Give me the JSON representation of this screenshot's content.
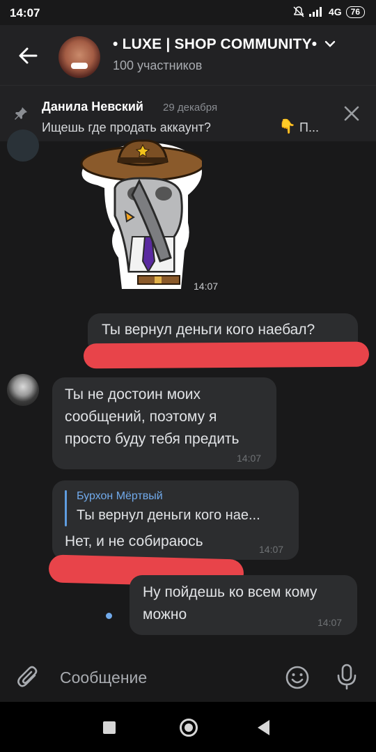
{
  "status_bar": {
    "time": "14:07",
    "network": "4G",
    "battery": "76"
  },
  "header": {
    "title": "• LUXE | SHOP COMMUNITY•",
    "subtitle": "100 участников"
  },
  "pinned": {
    "author": "Данила Невский",
    "date": "29 декабря",
    "text": "Ищешь где продать аккаунт?",
    "emoji": "👇",
    "more": "П..."
  },
  "messages": {
    "sticker_time": "14:07",
    "m1": {
      "text": "Ты вернул деньги кого наебал?"
    },
    "m2": {
      "lines": [
        "Ты не достоин моих",
        "сообщений, поэтому я",
        "просто буду тебя предить"
      ],
      "time": "14:07"
    },
    "m3": {
      "reply_author": "Бурхон Мёртвый",
      "reply_text": "Ты вернул деньги кого нае...",
      "text": "Нет, и не собираюсь",
      "time": "14:07"
    },
    "m4": {
      "lines": [
        "Ну пойдешь ко всем кому",
        "можно"
      ],
      "time": "14:07"
    }
  },
  "composer": {
    "placeholder": "Сообщение"
  },
  "icons": {
    "back": "arrow-left-icon",
    "pin": "pin-icon",
    "close": "close-icon",
    "attach": "paperclip-icon",
    "emoji": "smile-icon",
    "mic": "microphone-icon"
  },
  "colors": {
    "background": "#19191a",
    "bubble": "#2c2d2f",
    "accent": "#71aaeb",
    "redaction": "#e8444a"
  }
}
